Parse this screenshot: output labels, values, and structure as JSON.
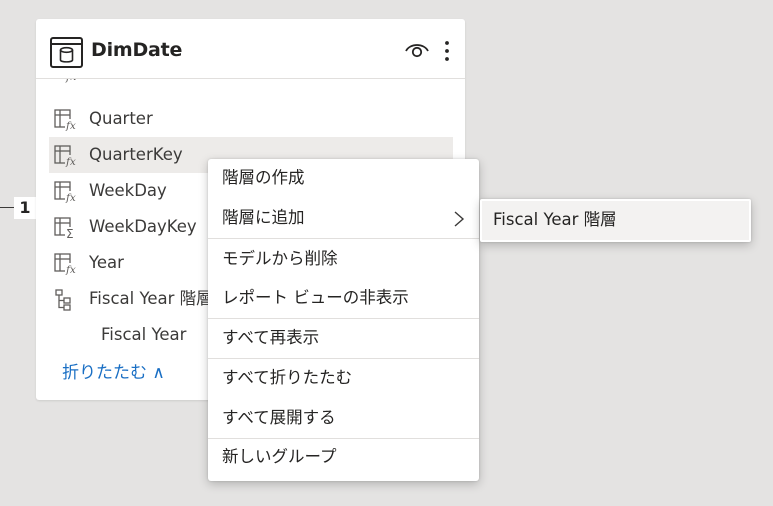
{
  "table_card": {
    "title": "DimDate",
    "icon": "table-icon",
    "header_actions": [
      "eye-icon",
      "more-icon"
    ],
    "fields": [
      {
        "label": "Quarter",
        "icon": "calculated-column-icon"
      },
      {
        "label": "QuarterKey",
        "icon": "calculated-column-icon",
        "hovered": true
      },
      {
        "label": "WeekDay",
        "icon": "calculated-column-icon"
      },
      {
        "label": "WeekDayKey",
        "icon": "summarized-column-icon"
      },
      {
        "label": "Year",
        "icon": "calculated-column-icon"
      },
      {
        "label": "Fiscal Year 階層",
        "icon": "hierarchy-icon"
      },
      {
        "label": "Fiscal Year",
        "icon": ""
      }
    ],
    "collapse_link": "折りたたむ ∧"
  },
  "relationship": {
    "cardinality": "1"
  },
  "context_menu": {
    "items": [
      {
        "label": "階層の作成"
      },
      {
        "label": "階層に追加",
        "has_submenu": true
      },
      {
        "label": "モデルから削除"
      },
      {
        "label": "レポート ビューの非表示"
      },
      {
        "label": "すべて再表示"
      },
      {
        "label": "すべて折りたたむ"
      },
      {
        "label": "すべて展開する"
      },
      {
        "label": "新しいグループ"
      }
    ]
  },
  "submenu": {
    "items": [
      {
        "label": "Fiscal Year 階層"
      }
    ]
  }
}
